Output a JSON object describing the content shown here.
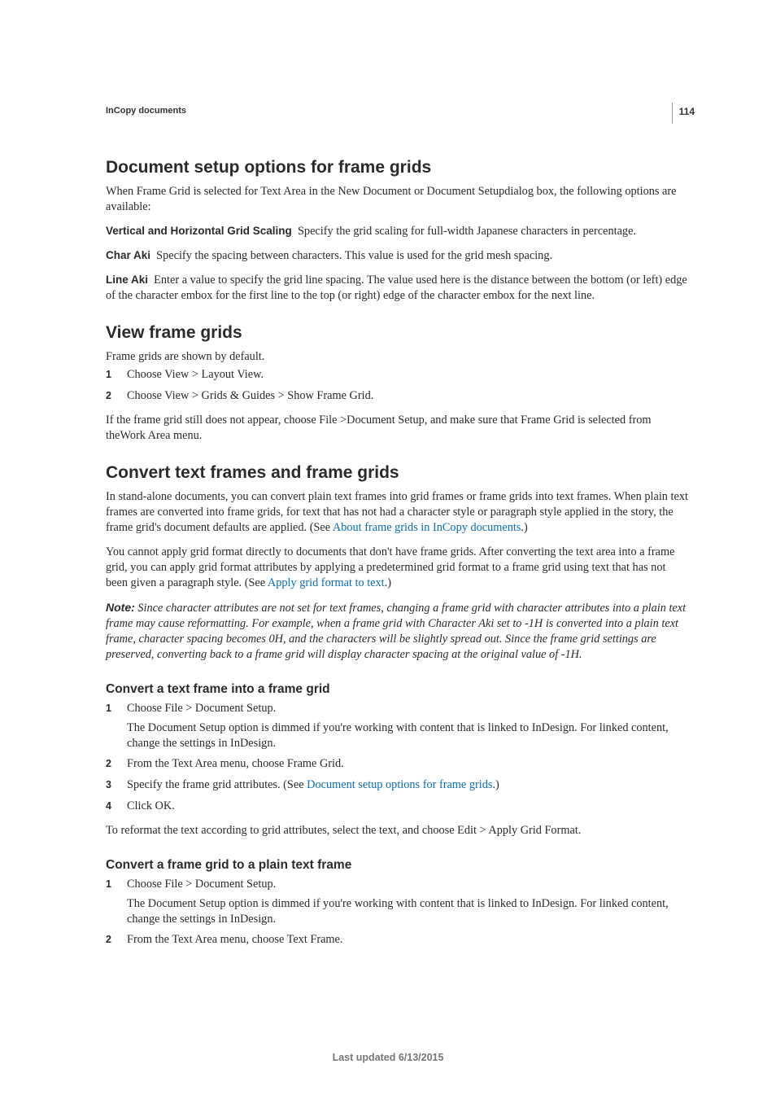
{
  "pageNumber": "114",
  "sectionLabel": "InCopy documents",
  "footer": "Last updated 6/13/2015",
  "s1": {
    "title": "Document setup options for frame grids",
    "intro": "When Frame Grid is selected for Text Area in the New Document or Document Setupdialog box, the following options are available:",
    "items": [
      {
        "term": "Vertical and Horizontal Grid Scaling",
        "desc": "Specify the grid scaling for full-width Japanese characters in percentage."
      },
      {
        "term": "Char Aki",
        "desc": "Specify the spacing between characters. This value is used for the grid mesh spacing."
      },
      {
        "term": "Line Aki",
        "desc": "Enter a value to specify the grid line spacing. The value used here is the distance between the bottom (or left) edge of the character embox for the first line to the top (or right) edge of the character embox for the next line."
      }
    ]
  },
  "s2": {
    "title": "View frame grids",
    "intro": "Frame grids are shown by default.",
    "steps": [
      "Choose View > Layout View.",
      "Choose View > Grids & Guides > Show Frame Grid."
    ],
    "after": "If the frame grid still does not appear, choose File >Document Setup, and make sure that Frame Grid is selected from theWork Area menu."
  },
  "s3": {
    "title": "Convert text frames and frame grids",
    "p1a": "In stand-alone documents, you can convert plain text frames into grid frames or frame grids into text frames. When plain text frames are converted into frame grids, for text that has not had a character style or paragraph style applied in the story, the frame grid's document defaults are applied. (See ",
    "p1link": "About frame grids in InCopy documents",
    "p1b": ".)",
    "p2a": "You cannot apply grid format directly to documents that don't have frame grids. After converting the text area into a frame grid, you can apply grid format attributes by applying a predetermined grid format to a frame grid using text that has not been given a paragraph style. (See ",
    "p2link": "Apply grid format to text",
    "p2b": ".)",
    "noteLabel": "Note:",
    "noteBody": " Since character attributes are not set for text frames, changing a frame grid with character attributes into a plain text frame may cause reformatting. For example, when a frame grid with Character Aki set to -1H is converted into a plain text frame, character spacing becomes 0H, and the characters will be slightly spread out. Since the frame grid settings are preserved, converting back to a frame grid will display character spacing at the original value of -1H.",
    "sub1": {
      "title": "Convert a text frame into a frame grid",
      "steps": {
        "s1": "Choose File > Document Setup.",
        "s1p": "The Document Setup option is dimmed if you're working with content that is linked to InDesign. For linked content, change the settings in InDesign.",
        "s2": "From the Text Area menu, choose Frame Grid.",
        "s3a": "Specify the frame grid attributes. (See ",
        "s3link": "Document setup options for frame grids",
        "s3b": ".)",
        "s4": "Click OK."
      },
      "after": "To reformat the text according to grid attributes, select the text, and choose Edit > Apply Grid Format."
    },
    "sub2": {
      "title": "Convert a frame grid to a plain text frame",
      "steps": {
        "s1": "Choose File > Document Setup.",
        "s1p": "The Document Setup option is dimmed if you're working with content that is linked to InDesign. For linked content, change the settings in InDesign.",
        "s2": "From the Text Area menu, choose Text Frame."
      }
    }
  }
}
